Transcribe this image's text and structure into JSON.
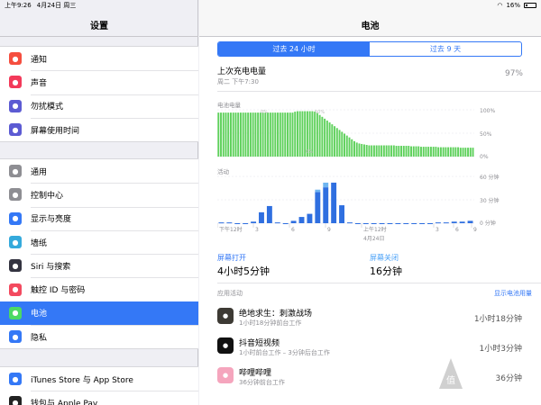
{
  "statusbar": {
    "time": "上午9:26",
    "date": "4月24日 周三",
    "battery": "16%"
  },
  "left": {
    "title": "设置",
    "groups": [
      [
        {
          "label": "通知",
          "icon": "notifications-icon",
          "color": "#f54e3f"
        },
        {
          "label": "声音",
          "icon": "sound-icon",
          "color": "#f33a5a"
        },
        {
          "label": "勿扰模式",
          "icon": "moon-icon",
          "color": "#5c5bd3"
        },
        {
          "label": "屏幕使用时间",
          "icon": "hourglass-icon",
          "color": "#5c5bd3"
        }
      ],
      [
        {
          "label": "通用",
          "icon": "gear-icon",
          "color": "#8e8e93"
        },
        {
          "label": "控制中心",
          "icon": "switches-icon",
          "color": "#8e8e93"
        },
        {
          "label": "显示与亮度",
          "icon": "aa-icon",
          "color": "#3478f6"
        },
        {
          "label": "墙纸",
          "icon": "flower-icon",
          "color": "#35aadc"
        },
        {
          "label": "Siri 与搜索",
          "icon": "siri-icon",
          "color": "#333340"
        },
        {
          "label": "触控 ID 与密码",
          "icon": "fingerprint-icon",
          "color": "#f34a5f"
        },
        {
          "label": "电池",
          "icon": "battery-icon",
          "color": "#4cd964"
        },
        {
          "label": "隐私",
          "icon": "hand-icon",
          "color": "#3478f6"
        }
      ],
      [
        {
          "label": "iTunes Store 与 App Store",
          "icon": "app-store-icon",
          "color": "#3478f6"
        },
        {
          "label": "钱包与 Apple Pay",
          "icon": "wallet-icon",
          "color": "#222222"
        }
      ]
    ]
  },
  "right": {
    "title": "电池",
    "seg": {
      "a": "过去 24 小时",
      "b": "过去 9 天"
    },
    "last_charge": {
      "label": "上次充电电量",
      "sub": "周二 下午7:30",
      "value": "97%"
    },
    "battery_chart": {
      "label": "电池电量",
      "ylabels": [
        "100%",
        "50%",
        "0%"
      ],
      "inline_labels": [
        "0%",
        "50%",
        "0%"
      ]
    },
    "activity_chart": {
      "label": "活动",
      "ylabels": [
        "60 分钟",
        "30 分钟",
        "0 分钟"
      ],
      "xlabels": [
        "下午12时",
        "3",
        "6",
        "9",
        "上午12时",
        "3",
        "6",
        "9"
      ],
      "date_label": "4月24日"
    },
    "screen_on": {
      "label": "屏幕打开",
      "value": "4小时5分钟"
    },
    "screen_off": {
      "label": "屏幕关闭",
      "value": "16分钟"
    },
    "app_activity": "应用活动",
    "show_usage": "显示电池用量",
    "apps": [
      {
        "name": "绝地求生：刺激战场",
        "detail": "1小时18分钟前台工作",
        "time": "1小时18分钟",
        "icon": "pubg-icon",
        "color": "#3d3a34"
      },
      {
        "name": "抖音短视频",
        "detail": "1小时前台工作 – 3分钟后台工作",
        "time": "1小时3分钟",
        "icon": "tiktok-icon",
        "color": "#111111"
      },
      {
        "name": "哔哩哔哩",
        "detail": "36分钟前台工作",
        "time": "36分钟",
        "icon": "bilibili-icon",
        "color": "#f5a5bd"
      }
    ]
  },
  "chart_data": [
    {
      "type": "bar",
      "label": "电池电量",
      "ylim": [
        0,
        100
      ],
      "ylabels": [
        "0%",
        "50%",
        "100%"
      ],
      "values": [
        94,
        94,
        94,
        94,
        94,
        94,
        94,
        94,
        94,
        94,
        94,
        94,
        94,
        94,
        94,
        94,
        94,
        94,
        94,
        94,
        94,
        94,
        94,
        94,
        94,
        94,
        94,
        94,
        94,
        94,
        94,
        96,
        97,
        97,
        97,
        97,
        97,
        97,
        97,
        96,
        93,
        89,
        85,
        81,
        77,
        73,
        69,
        65,
        61,
        57,
        53,
        49,
        45,
        41,
        37,
        33,
        30,
        28,
        27,
        26,
        25,
        24,
        24,
        24,
        24,
        24,
        24,
        24,
        24,
        24,
        24,
        24,
        23,
        23,
        23,
        23,
        23,
        23,
        22,
        22,
        22,
        22,
        21,
        21,
        21,
        21,
        21,
        21,
        21,
        20,
        20,
        20,
        20,
        20,
        20,
        20,
        20,
        20,
        19,
        19,
        19,
        19,
        19,
        19
      ]
    },
    {
      "type": "bar",
      "label": "活动",
      "ylim": [
        0,
        60
      ],
      "ylabels": [
        "0分钟",
        "30分钟",
        "60分钟"
      ],
      "xlabels": [
        "下午12时",
        "3",
        "6",
        "9",
        "上午12时",
        "3",
        "6",
        "9"
      ],
      "series": [
        {
          "name": "屏幕打开",
          "values": [
            1,
            1,
            0,
            0,
            2,
            14,
            22,
            1,
            0,
            3,
            8,
            12,
            40,
            46,
            52,
            23,
            1,
            0,
            0,
            0,
            0,
            0,
            0,
            0,
            0,
            0,
            0,
            1,
            1,
            2,
            2,
            3
          ]
        },
        {
          "name": "屏幕关闭",
          "values": [
            0,
            0,
            0,
            0,
            0,
            0,
            0,
            0,
            0,
            0,
            0,
            0,
            3,
            6,
            0,
            0,
            0,
            0,
            0,
            0,
            0,
            0,
            0,
            0,
            0,
            0,
            0,
            0,
            0,
            0,
            0,
            0
          ]
        }
      ]
    }
  ]
}
